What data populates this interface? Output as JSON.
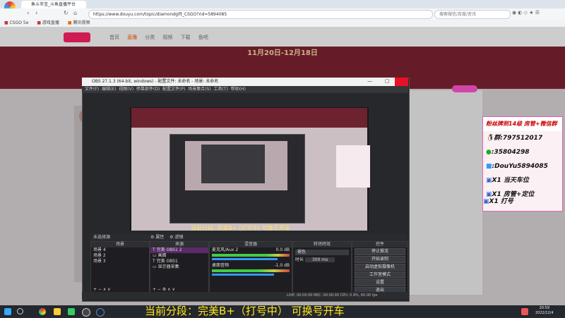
{
  "browser": {
    "tab_title": "鱼斗市宝_斗鱼直播平台",
    "url": "https://www.douyu.com/topic/diamondgift_CSGO?rid=5894085",
    "search_placeholder": "搜索微信/百度/资讯",
    "bookmarks": [
      "CSGO 5e",
      "游戏直播",
      "腾讯视频"
    ]
  },
  "site": {
    "nav": [
      "首页",
      "直播",
      "分类",
      "视频",
      "下载",
      "鱼吧"
    ],
    "banner_date": "11月20日-12月18日"
  },
  "side_panel": {
    "title": "粉丝牌到14级 房管+微信群",
    "lines": [
      "群:797512017",
      ":35804298",
      ":DouYu5894085",
      "X1 当天车位",
      "X1 房管+定位",
      "X1 打号"
    ]
  },
  "obs": {
    "window_title": "OBS 27.1.3 (64-bit, windows) - 配置文件: 未命名 - 场景: 未命名",
    "menu": [
      "文件(F)",
      "编辑(E)",
      "视图(V)",
      "停靠部件(D)",
      "配置文件(P)",
      "场景集合(S)",
      "工具(T)",
      "帮助(H)"
    ],
    "no_source": "未选择源",
    "props_button": "属性",
    "filters_button": "滤镜",
    "scenes_header": "场景",
    "scenes": [
      "场景 4",
      "场景 2",
      "场景 3"
    ],
    "sources_header": "来源",
    "sources": [
      "完美 OBS1 2",
      "画面",
      "完美 OBS1",
      "显示器采集"
    ],
    "mixer_header": "混音器",
    "mixer": [
      {
        "name": "麦克风/Aux 2",
        "level": "0.0 dB"
      },
      {
        "name": "桌面音频",
        "level": "-1.0 dB"
      }
    ],
    "transitions_header": "转场特效",
    "transition": "褪色",
    "duration_label": "时长",
    "duration": "300 ms",
    "controls_header": "控件",
    "controls": [
      "停止推流",
      "开始录制",
      "启动虚拟摄像机",
      "工作室模式",
      "设置",
      "退出"
    ],
    "status": "LIVE: 00:00:00   REC: 00:00:00   CPU: 0.9%, 60.00 fps",
    "preview_subtitle": "当前分段: 完美B+ (打号中) 可换号开车"
  },
  "subtitle": "当前分段：完美B+（打号中） 可换号开车",
  "taskbar": {
    "time": "20:59",
    "date": "2022/12/4"
  }
}
